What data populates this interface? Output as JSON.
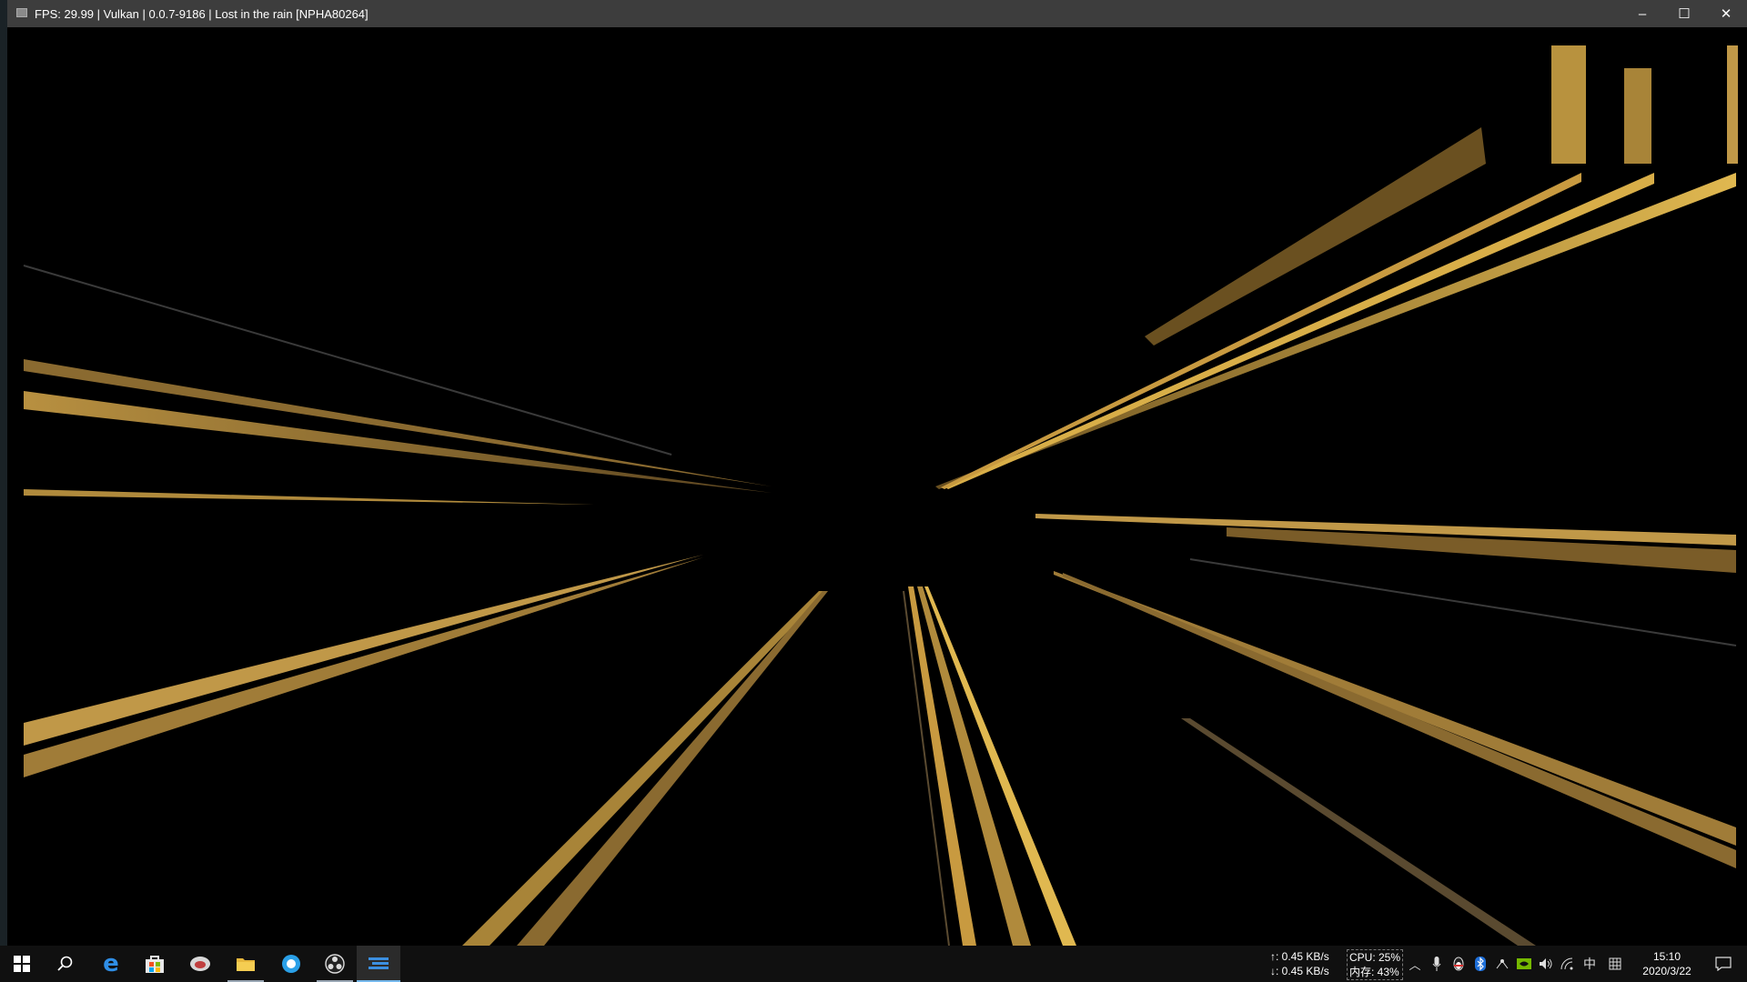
{
  "window": {
    "title": "FPS: 29.99 | Vulkan | 0.0.7-9186 | Lost in the rain [NPHA80264]",
    "minimize_glyph": "–",
    "maximize_glyph": "☐",
    "close_glyph": "✕"
  },
  "game": {
    "background": "#000000",
    "accent": "#c8a040"
  },
  "taskbar": {
    "apps": [
      {
        "name": "start-button",
        "icon": "windows-logo-icon"
      },
      {
        "name": "search-button",
        "icon": "search-icon"
      },
      {
        "name": "taskbar-edge",
        "icon": "edge-icon"
      },
      {
        "name": "taskbar-store",
        "icon": "store-icon"
      },
      {
        "name": "taskbar-app-4",
        "icon": "app-icon"
      },
      {
        "name": "taskbar-file-explorer",
        "icon": "folder-icon"
      },
      {
        "name": "taskbar-app-6",
        "icon": "browser-icon"
      },
      {
        "name": "taskbar-obs",
        "icon": "obs-icon"
      },
      {
        "name": "taskbar-emulator",
        "icon": "emulator-icon"
      }
    ],
    "net_up": "↑: 0.45 KB/s",
    "net_down": "↓: 0.45 KB/s",
    "cpu": "CPU: 25%",
    "mem": "内存: 43%",
    "ime": "中",
    "time": "15:10",
    "date": "2020/3/22"
  }
}
